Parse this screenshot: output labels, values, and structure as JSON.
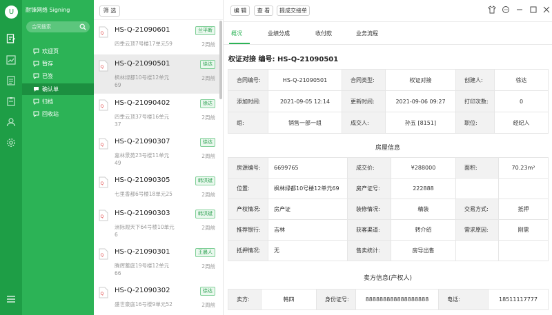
{
  "rail": {
    "avatar_letter": "U"
  },
  "app": {
    "title": "耐锋网络 Signing",
    "search_placeholder": "合同搜索",
    "nav": [
      {
        "label": "欢迎页",
        "active": false
      },
      {
        "label": "暂存",
        "active": false
      },
      {
        "label": "已签",
        "active": false
      },
      {
        "label": "确认单",
        "active": true
      },
      {
        "label": "归档",
        "active": false
      },
      {
        "label": "回收站",
        "active": false
      }
    ]
  },
  "list": {
    "filter_label": "筛 选",
    "items": [
      {
        "id": "HS-Q-21090601",
        "addr": "四季云顶7号楼17单元59",
        "tag": "兰平断",
        "time": "2周前",
        "selected": false
      },
      {
        "id": "HS-Q-21090501",
        "addr": "枫林绿都10号楼12单元69",
        "tag": "徐达",
        "time": "2周前",
        "selected": true
      },
      {
        "id": "HS-Q-21090402",
        "addr": "四季云顶37号楼16单元37",
        "tag": "徐达",
        "time": "2周前",
        "selected": false
      },
      {
        "id": "HS-Q-21090307",
        "addr": "嘉林景苑23号楼11单元49",
        "tag": "徐达",
        "time": "2周前",
        "selected": false
      },
      {
        "id": "HS-Q-21090305",
        "addr": "七里香都6号楼18单元25",
        "tag": "韩洪斌",
        "time": "2周前",
        "selected": false
      },
      {
        "id": "HS-Q-21090303",
        "addr": "洲际观天下64号楼10单元6",
        "tag": "韩洪斌",
        "time": "2周前",
        "selected": false
      },
      {
        "id": "HS-Q-21090301",
        "addr": "腾辉蓄庭19号楼12单元66",
        "tag": "王晨人",
        "time": "2周前",
        "selected": false
      },
      {
        "id": "HS-Q-21090302",
        "addr": "盛世豪庭16号楼9单元52",
        "tag": "徐达",
        "time": "2周前",
        "selected": false
      }
    ]
  },
  "toolbar": {
    "edit_label": "编 辑",
    "view_label": "查 看",
    "submit_label": "提成交接单"
  },
  "tabs": [
    "概况",
    "业绩分成",
    "收付款",
    "业务流程"
  ],
  "detail": {
    "title": "权证对接 编号:",
    "number": "HS-Q-21090501",
    "contract_rows": [
      [
        {
          "k": "合同编号:",
          "v": "HS-Q-21090501"
        },
        {
          "k": "合同类型:",
          "v": "权证对接"
        },
        {
          "k": "创建人:",
          "v": "徐达"
        }
      ],
      [
        {
          "k": "添加时间:",
          "v": "2021-09-05 12:14"
        },
        {
          "k": "更新时间:",
          "v": "2021-09-06 09:27"
        },
        {
          "k": "打印次数:",
          "v": "0"
        }
      ],
      [
        {
          "k": "组:",
          "v": "销售一部一组"
        },
        {
          "k": "成交人:",
          "v": "孙五 [8151]"
        },
        {
          "k": "职位:",
          "v": "经纪人"
        }
      ]
    ],
    "house_title": "房屋信息",
    "house_rows": [
      [
        {
          "k": "房源编号:",
          "v": "6699765"
        },
        {
          "k": "成交价:",
          "v": "¥288000"
        },
        {
          "k": "面积:",
          "v": "70.23m²"
        }
      ],
      [
        {
          "k": "位置:",
          "v": "枫林绿都10号楼12单元69"
        },
        {
          "k": "房产证号:",
          "v": "222888"
        },
        {
          "k": "",
          "v": ""
        }
      ],
      [
        {
          "k": "产权情况:",
          "v": "房产证"
        },
        {
          "k": "装修情况:",
          "v": "精装"
        },
        {
          "k": "交易方式:",
          "v": "抵押"
        }
      ],
      [
        {
          "k": "推荐银行:",
          "v": "吉林"
        },
        {
          "k": "获客渠道:",
          "v": "转介绍"
        },
        {
          "k": "需求原因:",
          "v": "刚需"
        }
      ],
      [
        {
          "k": "抵押情况:",
          "v": "无"
        },
        {
          "k": "售卖统计:",
          "v": "房导出售"
        },
        {
          "k": "",
          "v": ""
        }
      ]
    ],
    "seller_title": "卖方信息(产权人)",
    "seller_row": [
      {
        "k": "卖方:",
        "v": "韩四"
      },
      {
        "k": "身份证号:",
        "v": "888888888888888888"
      },
      {
        "k": "电话:",
        "v": "18511117777"
      }
    ]
  },
  "colors": {
    "rail": "#1e9e46",
    "sidebar": "#2cb356",
    "accent": "#2cb356",
    "tag_bg": "#eaf8ee"
  }
}
